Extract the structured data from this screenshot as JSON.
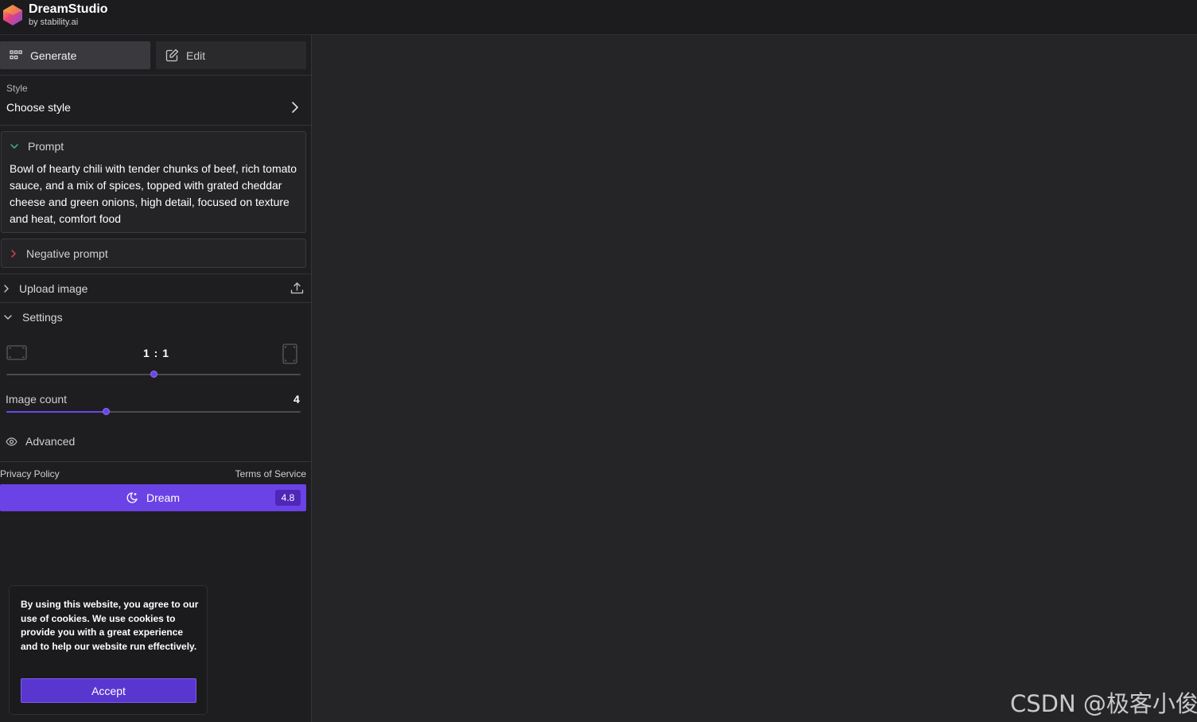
{
  "header": {
    "brand_name": "DreamStudio",
    "brand_sub": "by stability.ai"
  },
  "tabs": [
    {
      "label": "Generate",
      "icon": "grid-icon",
      "active": true
    },
    {
      "label": "Edit",
      "icon": "edit-icon",
      "active": false
    }
  ],
  "style": {
    "label": "Style",
    "value": "Choose style"
  },
  "prompt": {
    "label": "Prompt",
    "text": "Bowl of hearty chili with tender chunks of beef, rich tomato sauce, and a mix of spices, topped with grated cheddar cheese and green onions, high detail, focused on texture and heat, comfort food"
  },
  "negative_prompt": {
    "label": "Negative prompt"
  },
  "upload": {
    "label": "Upload image"
  },
  "settings": {
    "label": "Settings",
    "aspect_ratio": {
      "value": "1 : 1",
      "slider_fraction": 0.5
    },
    "image_count": {
      "label": "Image count",
      "value": "4",
      "slider_fraction": 0.34
    },
    "advanced_label": "Advanced"
  },
  "footer": {
    "privacy": "Privacy Policy",
    "terms": "Terms of Service"
  },
  "dream_button": {
    "label": "Dream",
    "cost": "4.8"
  },
  "cookie": {
    "text": "By using this website, you agree to our use of cookies. We use cookies to provide you with a great experience and to help our website run effectively.",
    "accept": "Accept"
  },
  "watermark": "CSDN @极客小俊",
  "colors": {
    "accent": "#6b42e6",
    "background": "#252528",
    "sidebar": "#1e1e21"
  }
}
